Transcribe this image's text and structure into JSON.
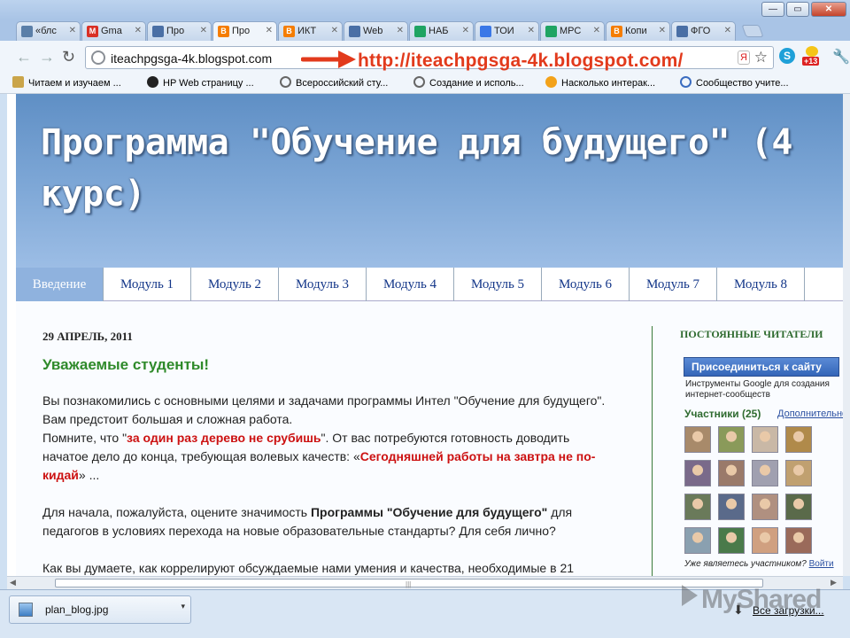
{
  "window": {
    "controls": [
      "—",
      "▭",
      "✕"
    ]
  },
  "tabs": [
    {
      "label": "«блс",
      "icon": "document-icon",
      "color": "#5b7fa8",
      "active": false
    },
    {
      "label": "Gma",
      "icon": "gmail-icon",
      "color": "#d93025",
      "active": false
    },
    {
      "label": "Про",
      "icon": "document-icon",
      "color": "#4a6fa5",
      "active": false
    },
    {
      "label": "Про",
      "icon": "blogger-icon",
      "color": "#f57d00",
      "active": true
    },
    {
      "label": "ИКТ",
      "icon": "blogger-icon",
      "color": "#f57d00",
      "active": false
    },
    {
      "label": "Web",
      "icon": "document-icon",
      "color": "#4a6fa5",
      "active": false
    },
    {
      "label": "НАБ",
      "icon": "spreadsheet-icon",
      "color": "#1fa463",
      "active": false
    },
    {
      "label": "ТОИ",
      "icon": "docs-icon",
      "color": "#3b78e7",
      "active": false
    },
    {
      "label": "МРС",
      "icon": "spreadsheet-icon",
      "color": "#1fa463",
      "active": false
    },
    {
      "label": "Копи",
      "icon": "blogger-icon",
      "color": "#f57d00",
      "active": false
    },
    {
      "label": "ФГО",
      "icon": "document-icon",
      "color": "#4a6fa5",
      "active": false
    }
  ],
  "toolbar": {
    "url": "iteachpgsga-4k.blogspot.com",
    "annotation_url": "http://iteachpgsga-4k.blogspot.com/",
    "badge": "+13"
  },
  "bookmarks": [
    {
      "label": "Читаем и изучаем ...",
      "icon": "folder-icon",
      "color": "#caa54a"
    },
    {
      "label": "HP Web страницу ...",
      "icon": "hp-icon",
      "color": "#222222"
    },
    {
      "label": "Всероссийский сту...",
      "icon": "globe-icon",
      "color": "#666666"
    },
    {
      "label": "Создание и исполь...",
      "icon": "globe-icon",
      "color": "#666666"
    },
    {
      "label": "Насколько интерак...",
      "icon": "orange-icon",
      "color": "#f3a21a"
    },
    {
      "label": "Сообщество учите...",
      "icon": "intel-icon",
      "color": "#3a6cc0"
    }
  ],
  "blog": {
    "title": "Программа \"Обучение для будущего\" (4 курс)",
    "nav": [
      "Введение",
      "Модуль 1",
      "Модуль 2",
      "Модуль 3",
      "Модуль 4",
      "Модуль 5",
      "Модуль 6",
      "Модуль 7",
      "Модуль 8"
    ],
    "active_nav": "Введение",
    "date": "29 АПРЕЛЬ, 2011",
    "post_title": "Уважаемые студенты!",
    "p1_a": "Вы познакомились с основными целями и задачами программы Интел \"Обучение для будущего\". Вам предстоит большая и сложная работа.",
    "p1_b": "Помните, что \"",
    "p1_red1": "за один раз дерево не срубишь",
    "p1_c": "\". От вас потребуются готовность доводить начатое дело до конца, требующая волевых качеств: «",
    "p1_red2": "Сегодняшней работы на завтра не по-кидай",
    "p1_d": "» ...",
    "p2_a": "Для начала, пожалуйста, оцените значимость ",
    "p2_bold": "Программы \"Обучение для будущего\"",
    "p2_b": " для педагогов в условиях перехода на новые образовательные стандарты? Для себя лично?",
    "p3": "Как вы думаете, как коррелируют обсуждаемые нами умения и качества, необходимые в 21"
  },
  "sidebar": {
    "heading": "ПОСТОЯННЫЕ ЧИТАТЕЛИ",
    "join_button": "Присоединиться к сайту",
    "description": "Инструменты Google для создания интернет-сообществ",
    "members": "Участники (25)",
    "more": "Дополнительно",
    "question": "Уже являетесь участником?",
    "login": "Войти",
    "avatar_colors": [
      "#a88a6a",
      "#8a9a5a",
      "#c9b8a6",
      "#b08a4a",
      "#7a6a8a",
      "#9a7a6a",
      "#a0a0b0",
      "#c0a070",
      "#6a7a5a",
      "#5a6a8a",
      "#b09080",
      "#5a6a4a",
      "#8aa0b0",
      "#4a7a4a",
      "#d0a080",
      "#9a6a5a"
    ]
  },
  "downloads": {
    "file": "plan_blog.jpg",
    "all": "Все загрузки..."
  },
  "watermark": "MyShared"
}
